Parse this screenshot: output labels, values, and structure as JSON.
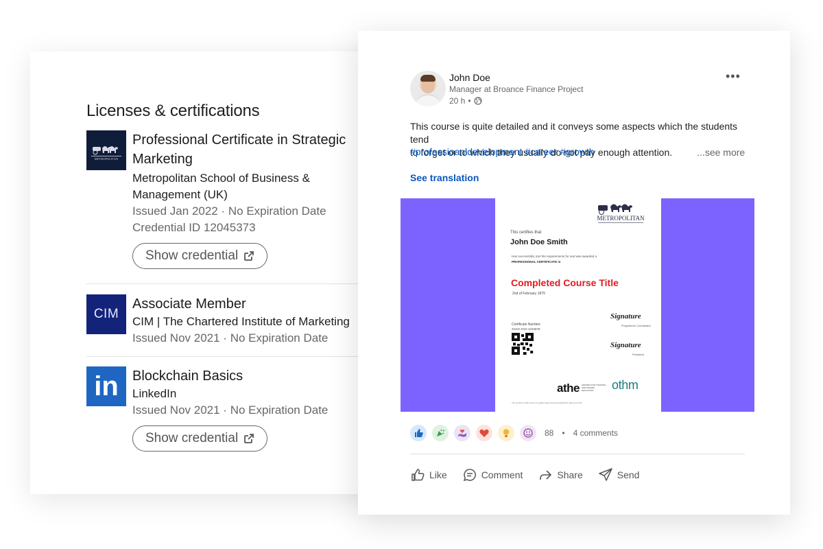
{
  "licenses": {
    "title": "Licenses & certifications",
    "items": [
      {
        "name_line1": "Professional Certificate in Strategic",
        "name_line2": "Marketing",
        "org_line1": "Metropolitan School of Business &",
        "org_line2": "Management (UK)",
        "issued": "Issued Jan 2022 · No Expiration Date",
        "credential_id": "Credential ID 12045373",
        "button": "Show credential",
        "logo_text": "METROPOLITAN"
      },
      {
        "name": "Associate Member",
        "org": "CIM | The Chartered Institute of Marketing",
        "issued": "Issued Nov 2021 · No Expiration Date",
        "logo_text": "CIM"
      },
      {
        "name": "Blockchain Basics",
        "org": "LinkedIn",
        "issued": "Issued Nov 2021 · No Expiration Date",
        "button": "Show credential",
        "logo_text": "in"
      }
    ]
  },
  "post": {
    "author": "John Doe",
    "author_title": "Manager at Broance Finance Project",
    "time": "20 h",
    "meta_separator": "•",
    "body_line1": "This course is quite detailed and it conveys some aspects which the students tend",
    "body_line2": "to forget or to which they usually do not pay enough attention.",
    "see_more": "...see more",
    "hashtags": [
      "#professioanldevelopment",
      "#career",
      "#growth"
    ],
    "see_translation": "See translation",
    "media_colors": {
      "background": "#7c62ff"
    },
    "certificate": {
      "brand": "METROPOLITAN",
      "certifies": "This certifies that",
      "recipient": "John Doe Smith",
      "met_text": "Has successfully met the requirements for and was awarded a",
      "award": "PROFESSIONAL CERTIFICATE in",
      "course": "Completed Course Title",
      "date": "2nd of February 1879",
      "cert_number_label": "Certificate Number:",
      "cert_number": "XXXX-XXX-1234578",
      "signature": "Signature",
      "sig1_role": "Programme Coordinator",
      "sig2_role": "President",
      "athe": "athe",
      "athe_sub": "AWARDS FOR TRAINING AND HIGHER EDUCATION",
      "othm": "othm",
      "footer": "The content of this course is quality assured and accredited by athe and othm"
    },
    "reactions": {
      "icons": [
        "like-icon",
        "celebrate-icon",
        "support-icon",
        "love-icon",
        "insightful-icon",
        "funny-icon"
      ],
      "count": "88",
      "separator": "•",
      "comments": "4 comments"
    },
    "actions": {
      "like": "Like",
      "comment": "Comment",
      "share": "Share",
      "send": "Send"
    },
    "more": "•••"
  }
}
